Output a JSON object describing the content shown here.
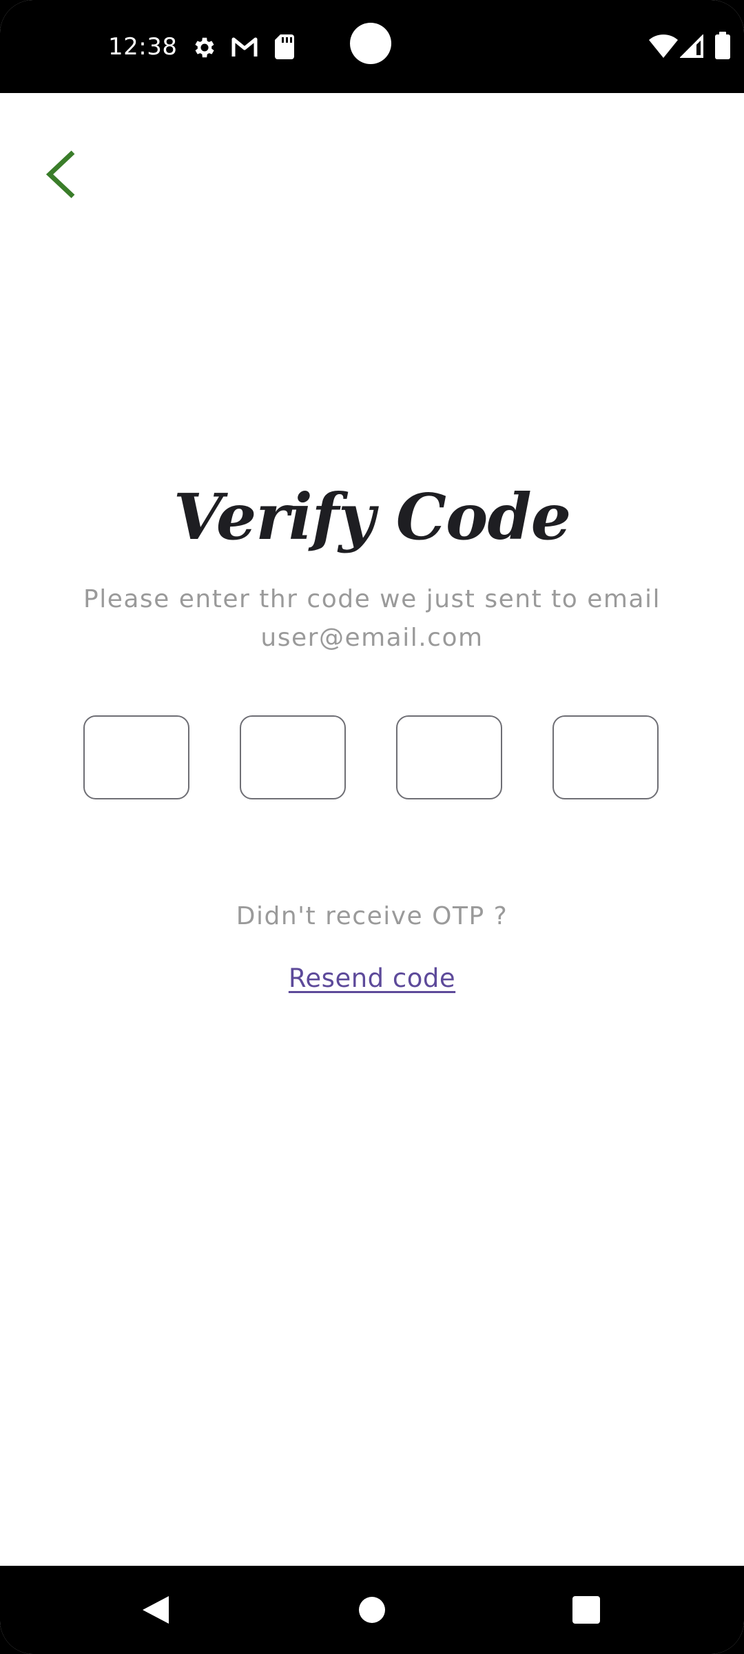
{
  "status_bar": {
    "time": "12:38",
    "left_icons": [
      "settings-icon",
      "gmail-icon",
      "sd-card-icon"
    ],
    "right_icons": [
      "wifi-icon",
      "signal-icon",
      "battery-icon"
    ]
  },
  "header": {
    "back_icon": "chevron-left-icon",
    "accent_color": "#3a7d2a"
  },
  "main": {
    "title": "Verify Code",
    "subtitle_line1": "Please enter thr code we just sent to email",
    "subtitle_line2": "user@email.com",
    "otp_boxes": [
      "",
      "",
      "",
      ""
    ],
    "no_otp_text": "Didn't receive OTP ?",
    "resend_label": "Resend code",
    "link_color": "#5d4a9a"
  },
  "nav_bar": {
    "buttons": [
      "back-triangle-icon",
      "home-circle-icon",
      "recents-square-icon"
    ]
  }
}
